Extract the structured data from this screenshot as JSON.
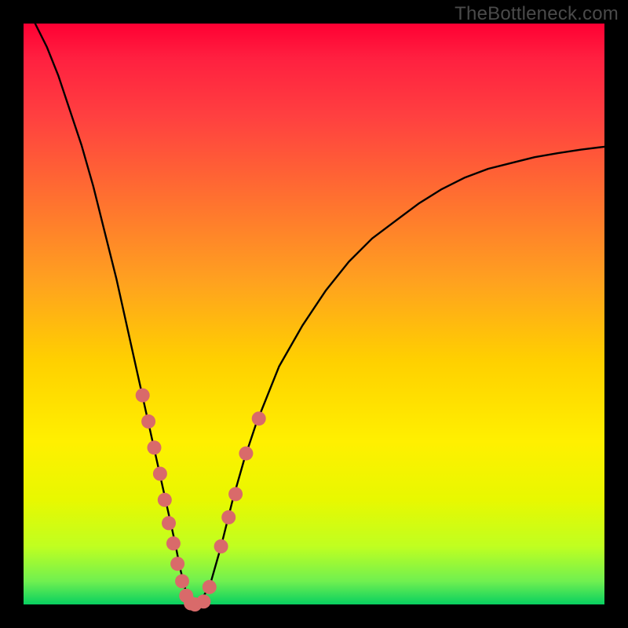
{
  "watermark": "TheBottleneck.com",
  "chart_data": {
    "type": "line",
    "title": "",
    "xlabel": "",
    "ylabel": "",
    "xlim": [
      0,
      100
    ],
    "ylim": [
      0,
      100
    ],
    "grid": false,
    "legend": false,
    "series": [
      {
        "name": "bottleneck-curve",
        "color": "#000000",
        "x": [
          2,
          4,
          6,
          8,
          10,
          12,
          14,
          16,
          18,
          20,
          22,
          24,
          26,
          27,
          28,
          29,
          30,
          32,
          34,
          36,
          38,
          40,
          44,
          48,
          52,
          56,
          60,
          64,
          68,
          72,
          76,
          80,
          84,
          88,
          92,
          96,
          100
        ],
        "y": [
          100,
          96,
          91,
          85,
          79,
          72,
          64,
          56,
          47,
          38,
          29,
          20,
          11,
          6,
          2,
          0,
          0,
          3,
          10,
          18,
          25,
          31,
          41,
          48,
          54,
          59,
          63,
          66,
          69,
          71.5,
          73.5,
          75,
          76,
          77,
          77.7,
          78.3,
          78.8
        ]
      }
    ],
    "markers": {
      "name": "highlighted-points",
      "color": "#d96a6a",
      "radius_px": 9,
      "x": [
        20.5,
        21.5,
        22.5,
        23.5,
        24.3,
        25.0,
        25.8,
        26.5,
        27.3,
        28.0,
        28.8,
        29.5,
        31.0,
        32.0,
        34.0,
        35.3,
        36.5,
        38.3,
        40.5
      ],
      "y": [
        36.0,
        31.5,
        27.0,
        22.5,
        18.0,
        14.0,
        10.5,
        7.0,
        4.0,
        1.5,
        0.2,
        0.0,
        0.5,
        3.0,
        10.0,
        15.0,
        19.0,
        26.0,
        32.0
      ]
    }
  }
}
